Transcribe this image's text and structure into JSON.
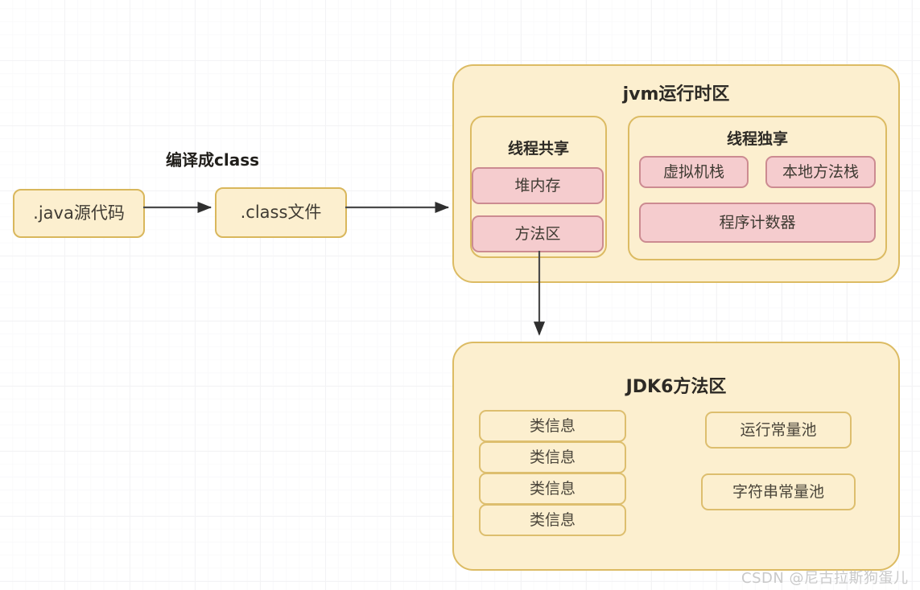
{
  "diagram": {
    "pipeline": {
      "source_box": ".java源代码",
      "edge_label": "编译成class",
      "class_box": ".class文件"
    },
    "jvm_runtime": {
      "title": "jvm运行时区",
      "thread_shared": {
        "title": "线程共享",
        "items": [
          "堆内存",
          "方法区"
        ]
      },
      "thread_private": {
        "title": "线程独享",
        "row1": [
          "虚拟机栈",
          "本地方法栈"
        ],
        "row2": [
          "程序计数器"
        ]
      }
    },
    "jdk6_method_area": {
      "title": "JDK6方法区",
      "class_info_stack": [
        "类信息",
        "类信息",
        "类信息",
        "类信息"
      ],
      "pools": [
        "运行常量池",
        "字符串常量池"
      ]
    },
    "connectors": {
      "source_to_class": "arrow-right",
      "class_to_jvm": "arrow-right",
      "method_area_to_jdk6": "arrow-down"
    },
    "colors": {
      "yellow_fill": "#fcefcf",
      "yellow_border": "#d9b75c",
      "pink_fill": "#f5ccce",
      "pink_border": "#cc8b91",
      "arrow": "#3c3c3c",
      "background": "#ffffff",
      "grid_line": "#f3f3f5",
      "watermark": "#c9c9c9"
    }
  },
  "watermark": {
    "text": "CSDN @尼古拉斯狗蛋儿"
  }
}
